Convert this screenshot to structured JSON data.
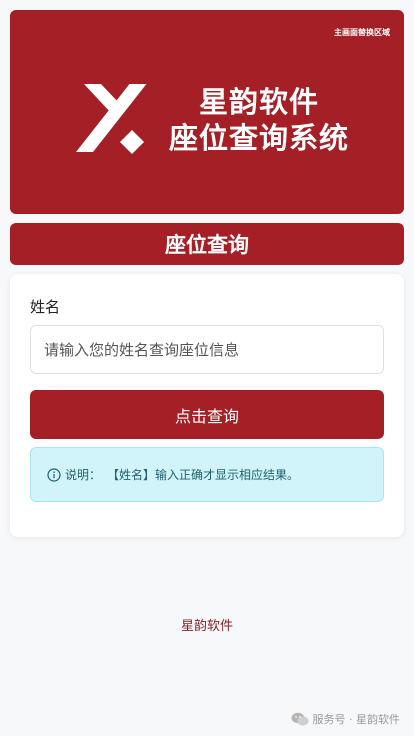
{
  "banner": {
    "corner_text": "主画面替换区域",
    "title_line1": "星韵软件",
    "title_line2": "座位查询系统",
    "logo_icon": "stylized-y-logo-icon"
  },
  "section_title": "座位查询",
  "form": {
    "name_label": "姓名",
    "name_value": "",
    "name_placeholder": "请输入您的姓名查询座位信息",
    "submit_label": "点击查询"
  },
  "notice": {
    "icon": "info-icon",
    "prefix": "说明：",
    "text": "【姓名】输入正确才显示相应结果。"
  },
  "footer": {
    "link_text": "星韵软件"
  },
  "watermark": {
    "icon": "wechat-icon",
    "text": "服务号 · 星韵软件"
  },
  "colors": {
    "brand": "#a41f26",
    "notice_bg": "#d1f4fa",
    "notice_border": "#a7e6f1",
    "page_bg": "#f7f8fa"
  }
}
